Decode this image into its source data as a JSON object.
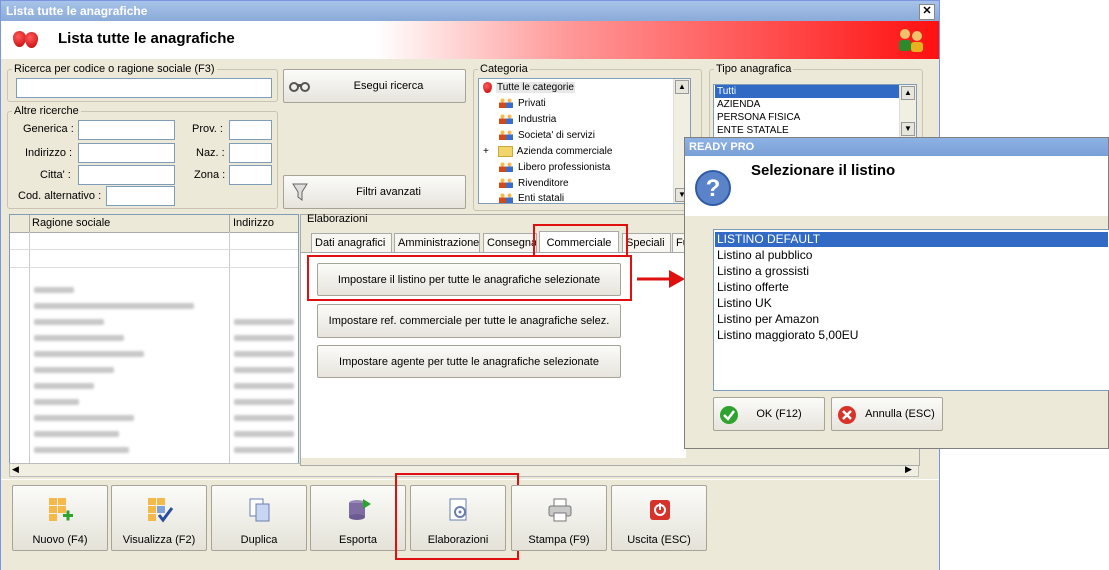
{
  "window": {
    "title": "Lista tutte le anagrafiche",
    "header_title": "Lista tutte le anagrafiche",
    "close_glyph": "✕"
  },
  "search": {
    "legend": "Ricerca per codice o ragione sociale (F3)",
    "value": "",
    "run_button": "Esegui ricerca",
    "altre_legend": "Altre ricerche",
    "labels": {
      "generica": "Generica :",
      "indirizzo": "Indirizzo :",
      "citta": "Citta' :",
      "cod_alt": "Cod. alternativo :",
      "prov": "Prov. :",
      "naz": "Naz. :",
      "zona": "Zona :"
    },
    "advanced_button": "Filtri avanzati"
  },
  "categoria": {
    "legend": "Categoria",
    "items": [
      {
        "label": "Tutte le categorie",
        "icon": "strawberry-icon",
        "selected": true
      },
      {
        "label": "Privati",
        "icon": "people-icon"
      },
      {
        "label": "Industria",
        "icon": "people-icon"
      },
      {
        "label": "Societa' di servizi",
        "icon": "people-icon"
      },
      {
        "label": "Azienda commerciale",
        "icon": "folder-icon",
        "expand": "+"
      },
      {
        "label": "Libero professionista",
        "icon": "people-icon"
      },
      {
        "label": "Rivenditore",
        "icon": "people-icon"
      },
      {
        "label": "Enti statali",
        "icon": "people-icon"
      }
    ]
  },
  "tipo": {
    "legend": "Tipo anagrafica",
    "items": [
      "Tutti",
      "AZIENDA",
      "PERSONA FISICA",
      "ENTE STATALE"
    ]
  },
  "grid": {
    "columns": [
      "Ragione sociale",
      "Indirizzo"
    ]
  },
  "elaborazioni": {
    "legend": "Elaborazioni",
    "tabs": [
      "Dati anagrafici",
      "Amministrazione",
      "Consegna",
      "Commerciale",
      "Speciali",
      "Fu"
    ],
    "active_tab": "Commerciale",
    "actions": [
      "Impostare il listino per tutte le anagrafiche selezionate",
      "Impostare ref. commerciale per tutte le anagrafiche selez.",
      "Impostare agente per tutte le anagrafiche selezionate"
    ]
  },
  "toolbar": [
    {
      "label": "Nuovo (F4)",
      "icon": "new-grid-icon"
    },
    {
      "label": "Visualizza (F2)",
      "icon": "view-grid-icon"
    },
    {
      "label": "Duplica",
      "icon": "duplicate-icon"
    },
    {
      "label": "Esporta",
      "icon": "export-database-icon"
    },
    {
      "label": "Elaborazioni",
      "icon": "process-gear-icon"
    },
    {
      "label": "Stampa (F9)",
      "icon": "printer-icon"
    },
    {
      "label": "Uscita (ESC)",
      "icon": "exit-icon"
    }
  ],
  "dialog": {
    "title": "READY PRO",
    "heading": "Selezionare il listino",
    "icon": "question-icon",
    "items": [
      "LISTINO DEFAULT",
      "Listino al pubblico",
      "Listino a grossisti",
      "Listino offerte",
      "Listino UK",
      "Listino per Amazon",
      "Listino maggiorato 5,00EU"
    ],
    "selected_index": 0,
    "ok_button": "OK (F12)",
    "cancel_button": "Annulla (ESC)"
  },
  "colors": {
    "highlight": "#e01010",
    "selection": "#316ac5",
    "panel": "#ece9d8"
  }
}
